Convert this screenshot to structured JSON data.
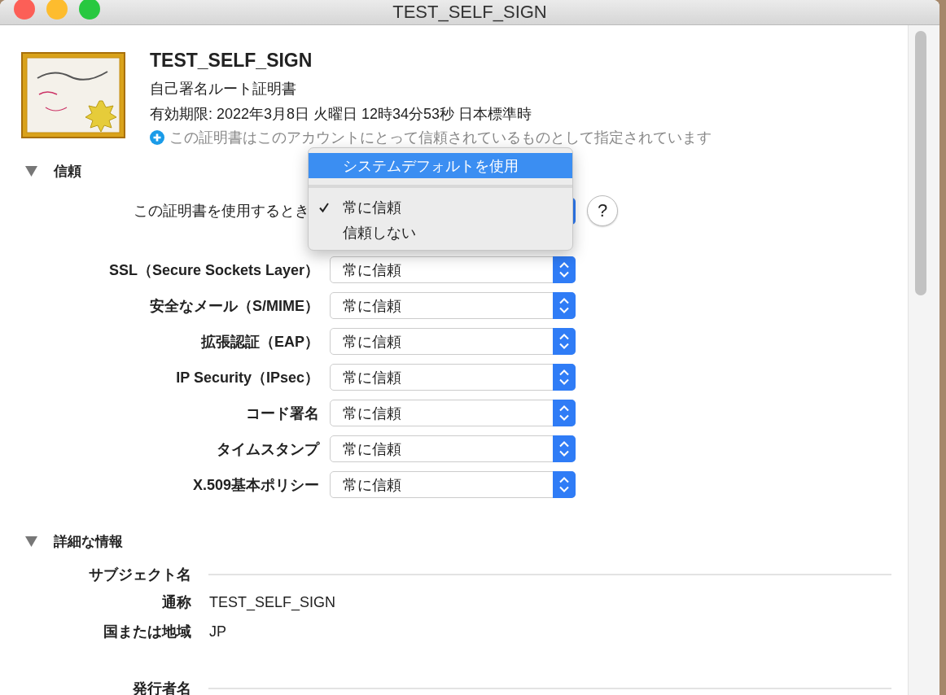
{
  "window": {
    "title": "TEST_SELF_SIGN"
  },
  "header": {
    "name": "TEST_SELF_SIGN",
    "type": "自己署名ルート証明書",
    "expires": "有効期限: 2022年3月8日 火曜日 12時34分53秒 日本標準時",
    "trust_note": "この証明書はこのアカウントにとって信頼されているものとして指定されています"
  },
  "trust": {
    "label": "信頼",
    "expanded": true,
    "when_using_label": "この証明書を使用するとき",
    "help_label": "?",
    "menu": [
      {
        "kind": "option",
        "label": "システムデフォルトを使用",
        "selected": true,
        "checked": false
      },
      {
        "kind": "separator"
      },
      {
        "kind": "option",
        "label": "常に信頼",
        "selected": false,
        "checked": true
      },
      {
        "kind": "option",
        "label": "信頼しない",
        "selected": false,
        "checked": false
      }
    ],
    "policies": [
      {
        "label": "SSL（Secure Sockets Layer）",
        "value": "常に信頼"
      },
      {
        "label": "安全なメール（S/MIME）",
        "value": "常に信頼"
      },
      {
        "label": "拡張認証（EAP）",
        "value": "常に信頼"
      },
      {
        "label": "IP Security（IPsec）",
        "value": "常に信頼"
      },
      {
        "label": "コード署名",
        "value": "常に信頼"
      },
      {
        "label": "タイムスタンプ",
        "value": "常に信頼"
      },
      {
        "label": "X.509基本ポリシー",
        "value": "常に信頼"
      }
    ]
  },
  "details": {
    "label": "詳細な情報",
    "expanded": true,
    "groups": [
      {
        "heading": "サブジェクト名",
        "fields": [
          {
            "label": "通称",
            "value": "TEST_SELF_SIGN"
          },
          {
            "label": "国または地域",
            "value": "JP"
          }
        ]
      },
      {
        "heading": "発行者名"
      }
    ]
  }
}
